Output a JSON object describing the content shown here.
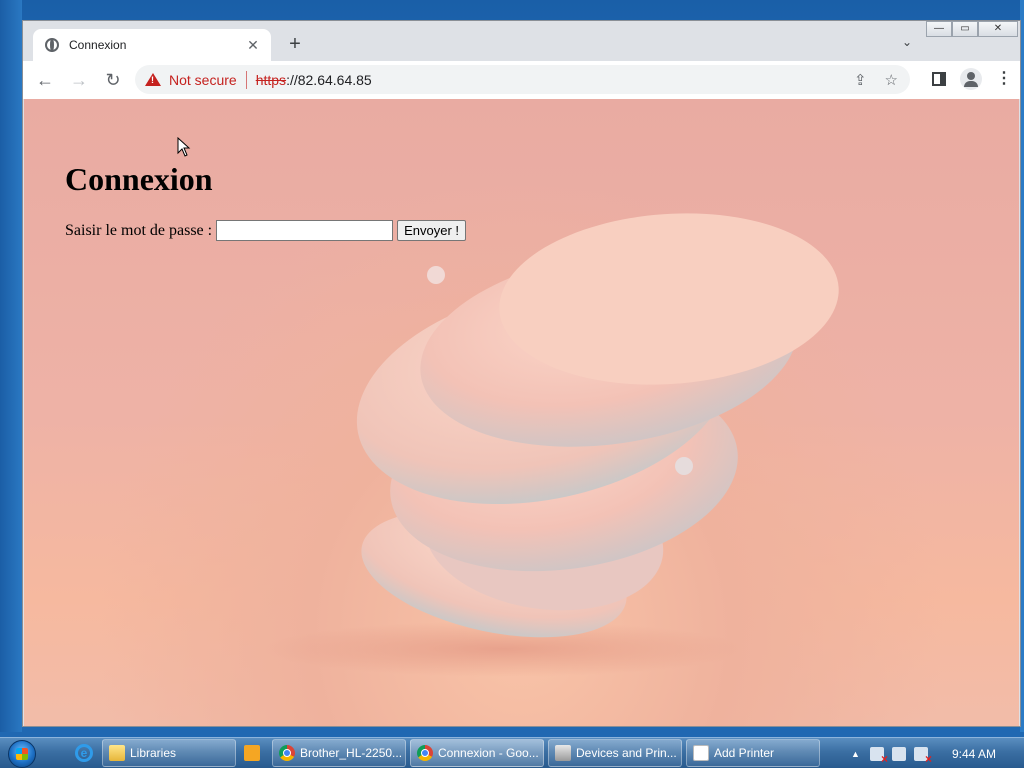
{
  "browser": {
    "tab_title": "Connexion",
    "tab_close": "✕",
    "new_tab": "+",
    "tab_search": "⌄",
    "back": "←",
    "forward": "→",
    "reload": "↻",
    "security_label": "Not secure",
    "url_scheme": "https",
    "url_rest": "://82.64.64.85",
    "share": "⇪",
    "bookmark": "☆",
    "menu": "⋮"
  },
  "window_controls": {
    "minimize": "—",
    "maximize": "▭",
    "close": "✕"
  },
  "page": {
    "heading": "Connexion",
    "password_label": "Saisir le mot de passe :",
    "password_value": "",
    "submit_label": "Envoyer !"
  },
  "taskbar": {
    "items": [
      {
        "label": "Libraries",
        "icon": "folder-icon"
      },
      {
        "label": "Brother_HL-2250...",
        "icon": "chrome-icon"
      },
      {
        "label": "Connexion - Goo...",
        "icon": "chrome-icon"
      },
      {
        "label": "Devices and Prin...",
        "icon": "printer-icon"
      },
      {
        "label": "Add Printer",
        "icon": "document-icon"
      }
    ],
    "tray_arrow": "▲",
    "clock": "9:44 AM"
  },
  "colors": {
    "not_secure_red": "#c5221f",
    "page_background": "#eeb2a6",
    "taskbar_blue": "#3b6fa3"
  }
}
